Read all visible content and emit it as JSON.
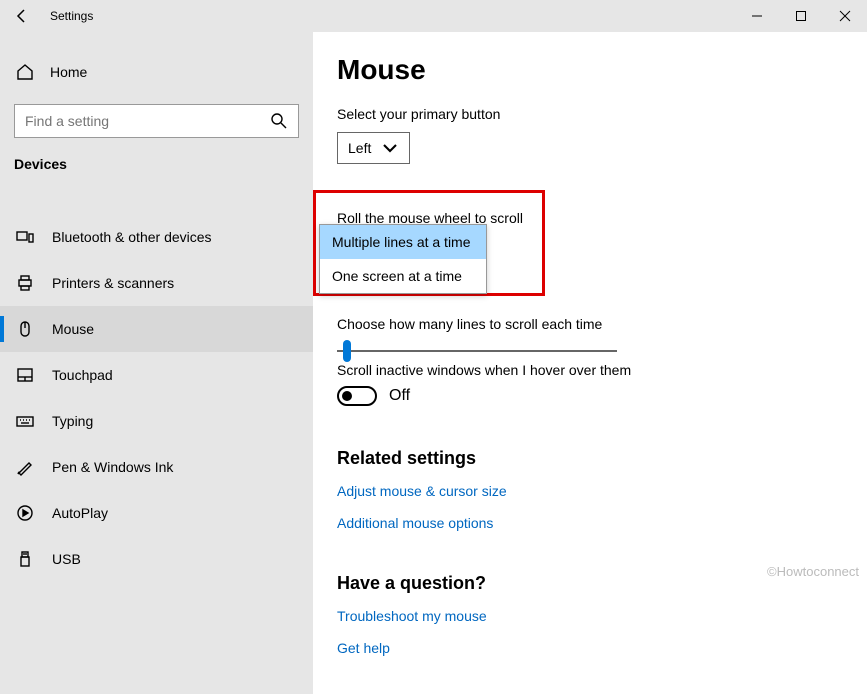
{
  "titlebar": {
    "app_title": "Settings"
  },
  "sidebar": {
    "home_label": "Home",
    "search_placeholder": "Find a setting",
    "category": "Devices",
    "items": [
      {
        "label": "Bluetooth & other devices"
      },
      {
        "label": "Printers & scanners"
      },
      {
        "label": "Mouse"
      },
      {
        "label": "Touchpad"
      },
      {
        "label": "Typing"
      },
      {
        "label": "Pen & Windows Ink"
      },
      {
        "label": "AutoPlay"
      },
      {
        "label": "USB"
      }
    ]
  },
  "content": {
    "heading": "Mouse",
    "primary_label": "Select your primary button",
    "primary_value": "Left",
    "roll_label": "Roll the mouse wheel to scroll",
    "roll_options": {
      "opt1": "Multiple lines at a time",
      "opt2": "One screen at a time"
    },
    "lines_label": "Choose how many lines to scroll each time",
    "hover_label": "Scroll inactive windows when I hover over them",
    "hover_value": "Off",
    "related_heading": "Related settings",
    "link_adjust": "Adjust mouse & cursor size",
    "link_additional": "Additional mouse options",
    "question_heading": "Have a question?",
    "link_troubleshoot": "Troubleshoot my mouse",
    "link_help": "Get help"
  },
  "watermark": "©Howtoconnect"
}
